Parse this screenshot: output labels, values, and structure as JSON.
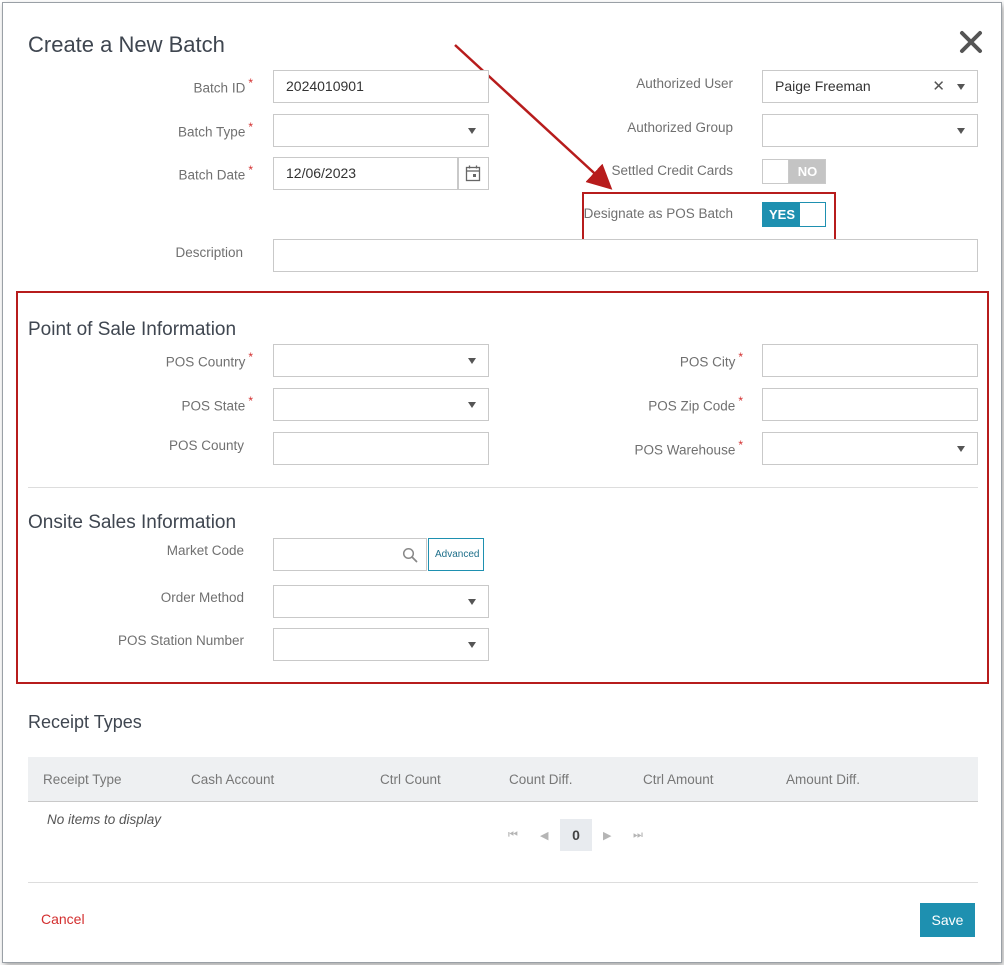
{
  "dialog": {
    "title": "Create a New Batch",
    "close_icon": "close-icon"
  },
  "batch": {
    "batch_id": {
      "label": "Batch ID",
      "value": "2024010901",
      "required": true
    },
    "batch_type": {
      "label": "Batch Type",
      "value": "",
      "required": true
    },
    "batch_date": {
      "label": "Batch Date",
      "value": "12/06/2023",
      "required": true
    },
    "authorized_user": {
      "label": "Authorized User",
      "value": "Paige Freeman"
    },
    "authorized_group": {
      "label": "Authorized Group",
      "value": ""
    },
    "settled_credit_cards": {
      "label": "Settled Credit Cards",
      "state": "NO"
    },
    "designate_pos": {
      "label": "Designate as POS Batch",
      "state": "YES"
    },
    "description": {
      "label": "Description",
      "value": ""
    }
  },
  "pos_section": {
    "title": "Point of Sale Information",
    "pos_country": {
      "label": "POS Country",
      "value": "",
      "required": true
    },
    "pos_state": {
      "label": "POS State",
      "value": "",
      "required": true
    },
    "pos_county": {
      "label": "POS County",
      "value": ""
    },
    "pos_city": {
      "label": "POS City",
      "value": "",
      "required": true
    },
    "pos_zip": {
      "label": "POS Zip Code",
      "value": "",
      "required": true
    },
    "pos_warehouse": {
      "label": "POS Warehouse",
      "value": "",
      "required": true
    }
  },
  "onsite_section": {
    "title": "Onsite Sales Information",
    "market_code": {
      "label": "Market Code",
      "value": "",
      "advanced_label": "Advanced"
    },
    "order_method": {
      "label": "Order Method",
      "value": ""
    },
    "pos_station": {
      "label": "POS Station Number",
      "value": ""
    }
  },
  "receipts": {
    "title": "Receipt Types",
    "columns": [
      "Receipt Type",
      "Cash Account",
      "Ctrl Count",
      "Count Diff.",
      "Ctrl Amount",
      "Amount Diff."
    ],
    "empty_text": "No items to display",
    "page": "0"
  },
  "footer": {
    "cancel_label": "Cancel",
    "save_label": "Save"
  },
  "colors": {
    "accent": "#1e90b0",
    "highlight_red": "#b71c1c",
    "cancel_red": "#d32f2f"
  }
}
